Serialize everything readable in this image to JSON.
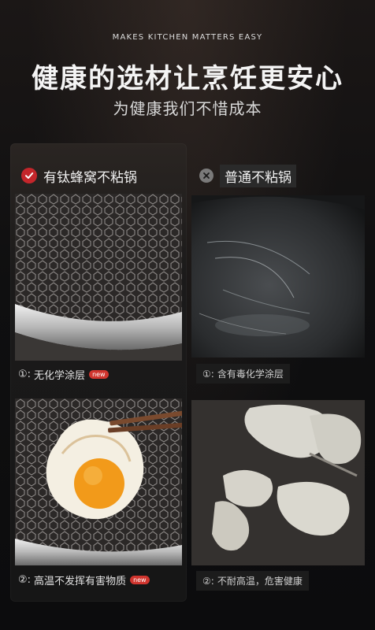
{
  "header": {
    "tagline": "MAKES KITCHEN MATTERS EASY",
    "title": "健康的选材让烹饪更安心",
    "subtitle": "为健康我们不惜成本"
  },
  "left": {
    "heading": "有钛蜂窝不粘锅",
    "caption1_num": "①:",
    "caption1": "无化学涂层",
    "caption2_num": "②:",
    "caption2": "高温不发挥有害物质",
    "badge": "new"
  },
  "right": {
    "heading": "普通不粘锅",
    "caption1_num": "①:",
    "caption1": "含有毒化学涂层",
    "caption2_num": "②:",
    "caption2": "不耐高温，危害健康"
  },
  "colors": {
    "accent_red": "#c4262b",
    "badge_red": "#d0352e",
    "background": "#121212"
  },
  "icons": {
    "left_heading_icon": "check-circle-icon",
    "right_heading_icon": "x-circle-icon"
  }
}
